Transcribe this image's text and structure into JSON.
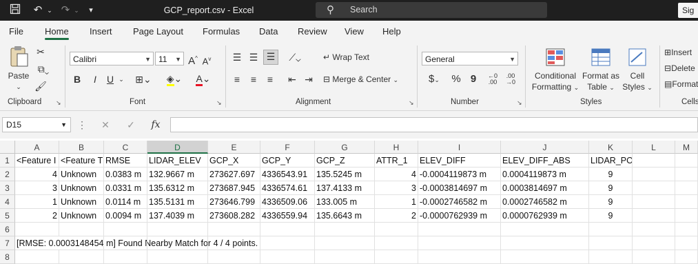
{
  "window": {
    "title": "GCP_report.csv  -  Excel",
    "search_placeholder": "Search",
    "signin_label": "Sig",
    "qat_icons": [
      "save-icon",
      "undo-icon",
      "redo-icon",
      "customize-qat-icon"
    ]
  },
  "ribbon": {
    "tabs": [
      "File",
      "Home",
      "Insert",
      "Page Layout",
      "Formulas",
      "Data",
      "Review",
      "View",
      "Help"
    ],
    "active_tab": "Home",
    "clipboard": {
      "paste": "Paste",
      "label": "Clipboard"
    },
    "font": {
      "name": "Calibri",
      "size": "11",
      "bold": "B",
      "italic": "I",
      "underline": "U",
      "grow": "A",
      "shrink": "A",
      "font_color": "A",
      "label": "Font"
    },
    "alignment": {
      "wrap_text": "Wrap Text",
      "merge_center": "Merge & Center",
      "label": "Alignment"
    },
    "number": {
      "format": "General",
      "currency": "$",
      "percent": "%",
      "comma": "9",
      "label": "Number"
    },
    "styles": {
      "conditional": [
        "Conditional",
        "Formatting"
      ],
      "format_table": [
        "Format as",
        "Table"
      ],
      "cell_styles": [
        "Cell",
        "Styles"
      ],
      "label": "Styles"
    },
    "cells": {
      "insert": "Insert",
      "delete": "Delete",
      "format": "Format",
      "label": "Cells"
    }
  },
  "formula_bar": {
    "name_box": "D15",
    "fx": "fx",
    "value": ""
  },
  "sheet": {
    "selected_column": "D",
    "columns": [
      "A",
      "B",
      "C",
      "D",
      "E",
      "F",
      "G",
      "H",
      "I",
      "J",
      "K",
      "L",
      "M"
    ],
    "rows": [
      {
        "num": "1",
        "cells": [
          "<Feature I",
          "<Feature T",
          "RMSE",
          "LIDAR_ELEV",
          "GCP_X",
          "GCP_Y",
          "GCP_Z",
          "ATTR_1",
          "ELEV_DIFF",
          "ELEV_DIFF_ABS",
          "LIDAR_POINT_COUNT",
          "",
          ""
        ]
      },
      {
        "num": "2",
        "cells": [
          "4",
          "Unknown",
          "0.0383 m",
          "132.9667 m",
          "273627.697",
          "4336543.91",
          "135.5245 m",
          "4",
          "-0.0004119873 m",
          "0.0004119873 m",
          "9",
          "",
          ""
        ]
      },
      {
        "num": "3",
        "cells": [
          "3",
          "Unknown",
          "0.0331 m",
          "135.6312 m",
          "273687.945",
          "4336574.61",
          "137.4133 m",
          "3",
          "-0.0003814697 m",
          "0.0003814697 m",
          "9",
          "",
          ""
        ]
      },
      {
        "num": "4",
        "cells": [
          "1",
          "Unknown",
          "0.0114 m",
          "135.5131 m",
          "273646.799",
          "4336509.06",
          "133.005 m",
          "1",
          "-0.0002746582 m",
          "0.0002746582 m",
          "9",
          "",
          ""
        ]
      },
      {
        "num": "5",
        "cells": [
          "2",
          "Unknown",
          "0.0094 m",
          "137.4039 m",
          "273608.282",
          "4336559.94",
          "135.6643 m",
          "2",
          "-0.0000762939 m",
          "0.0000762939 m",
          "9",
          "",
          ""
        ]
      },
      {
        "num": "6",
        "cells": [
          "",
          "",
          "",
          "",
          "",
          "",
          "",
          "",
          "",
          "",
          "",
          "",
          ""
        ]
      },
      {
        "num": "7",
        "cells": [
          "[RMSE: 0.0003148454 m] Found Nearby Match for 4 / 4 points.",
          "",
          "",
          "",
          "",
          "",
          "",
          "",
          "",
          "",
          "",
          "",
          ""
        ]
      },
      {
        "num": "8",
        "cells": [
          "",
          "",
          "",
          "",
          "",
          "",
          "",
          "",
          "",
          "",
          "",
          "",
          ""
        ]
      }
    ]
  },
  "colors": {
    "accent": "#1e7145",
    "titlebar": "#1f1f1f",
    "ribbon": "#f3f3f3"
  }
}
